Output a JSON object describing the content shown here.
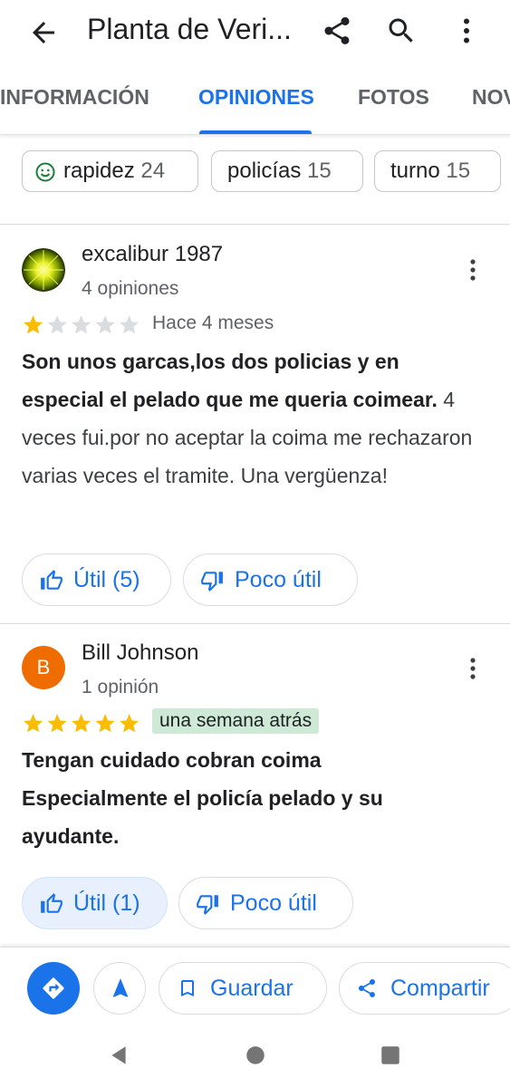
{
  "appbar": {
    "title": "Planta de Veri..."
  },
  "tabs": [
    "INFORMACIÓN",
    "OPINIONES",
    "FOTOS",
    "NOV"
  ],
  "chips": [
    {
      "label": "rapidez",
      "count": "24"
    },
    {
      "label": "policías",
      "count": "15"
    },
    {
      "label": "turno",
      "count": "15"
    }
  ],
  "reviews": [
    {
      "name": "excalibur 1987",
      "count": "4 opiniones",
      "rating": 1,
      "date": "Hace 4 meses",
      "bold_text": "Son unos garcas,los dos policias y en especial el pelado que me queria coimear.",
      "text": " 4 veces fui.por no aceptar la coima me rechazaron varias veces el tramite. Una vergüenza!",
      "helpful_label": "Útil (5)",
      "not_helpful_label": "Poco útil"
    },
    {
      "name": "Bill Johnson",
      "avatar_letter": "B",
      "avatar_color": "#ef6c00",
      "count": "1 opinión",
      "rating": 5,
      "date": "una semana atrás",
      "bold_text": "Tengan cuidado cobran coima Especialmente el policía pelado y su ayudante.",
      "helpful_label": "Útil (1)",
      "not_helpful_label": "Poco útil"
    }
  ],
  "actions": {
    "save_label": "Guardar",
    "share_label": "Compartir"
  },
  "colors": {
    "accent": "#1a73e8",
    "star": "#fbbc04",
    "star_empty": "#dadce0",
    "date_highlight": "#ceead6"
  }
}
